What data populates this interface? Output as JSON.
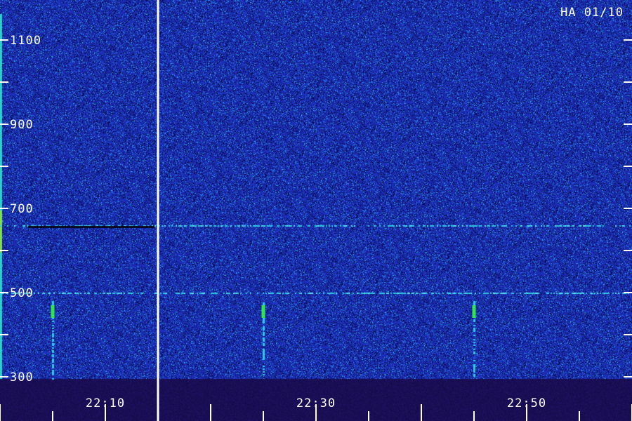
{
  "chart_data": {
    "type": "heatmap",
    "title": "",
    "station_tag": "HA 01/10",
    "xlabel": "",
    "ylabel": "",
    "y_ticks_labeled": [
      300,
      500,
      700,
      900,
      1100
    ],
    "y_ticks_minor": [
      400,
      600,
      800,
      1000
    ],
    "ylim": [
      290,
      1180
    ],
    "x_ticks_labeled": [
      "22:10",
      "22:30",
      "22:50"
    ],
    "x_range_minutes": [
      "22:00",
      "23:00"
    ],
    "grid": false,
    "features": {
      "horizontal_lines_hz": [
        500,
        660
      ],
      "green_marks": [
        {
          "time": "22:05",
          "band_hz": [
            440,
            470
          ]
        },
        {
          "time": "22:25",
          "band_hz": [
            440,
            470
          ]
        },
        {
          "time": "22:45",
          "band_hz": [
            440,
            470
          ]
        }
      ],
      "vertical_divider_time": "22:15"
    },
    "colors": {
      "background": "#1b2a9a",
      "speckle_light": "#3a5fe0",
      "speckle_dark": "#0b0f55",
      "line_cyan": "#31c8e8",
      "mark_green": "#2fe64a",
      "axis": "#ffffff",
      "bottom_band": "#1a1060"
    }
  }
}
